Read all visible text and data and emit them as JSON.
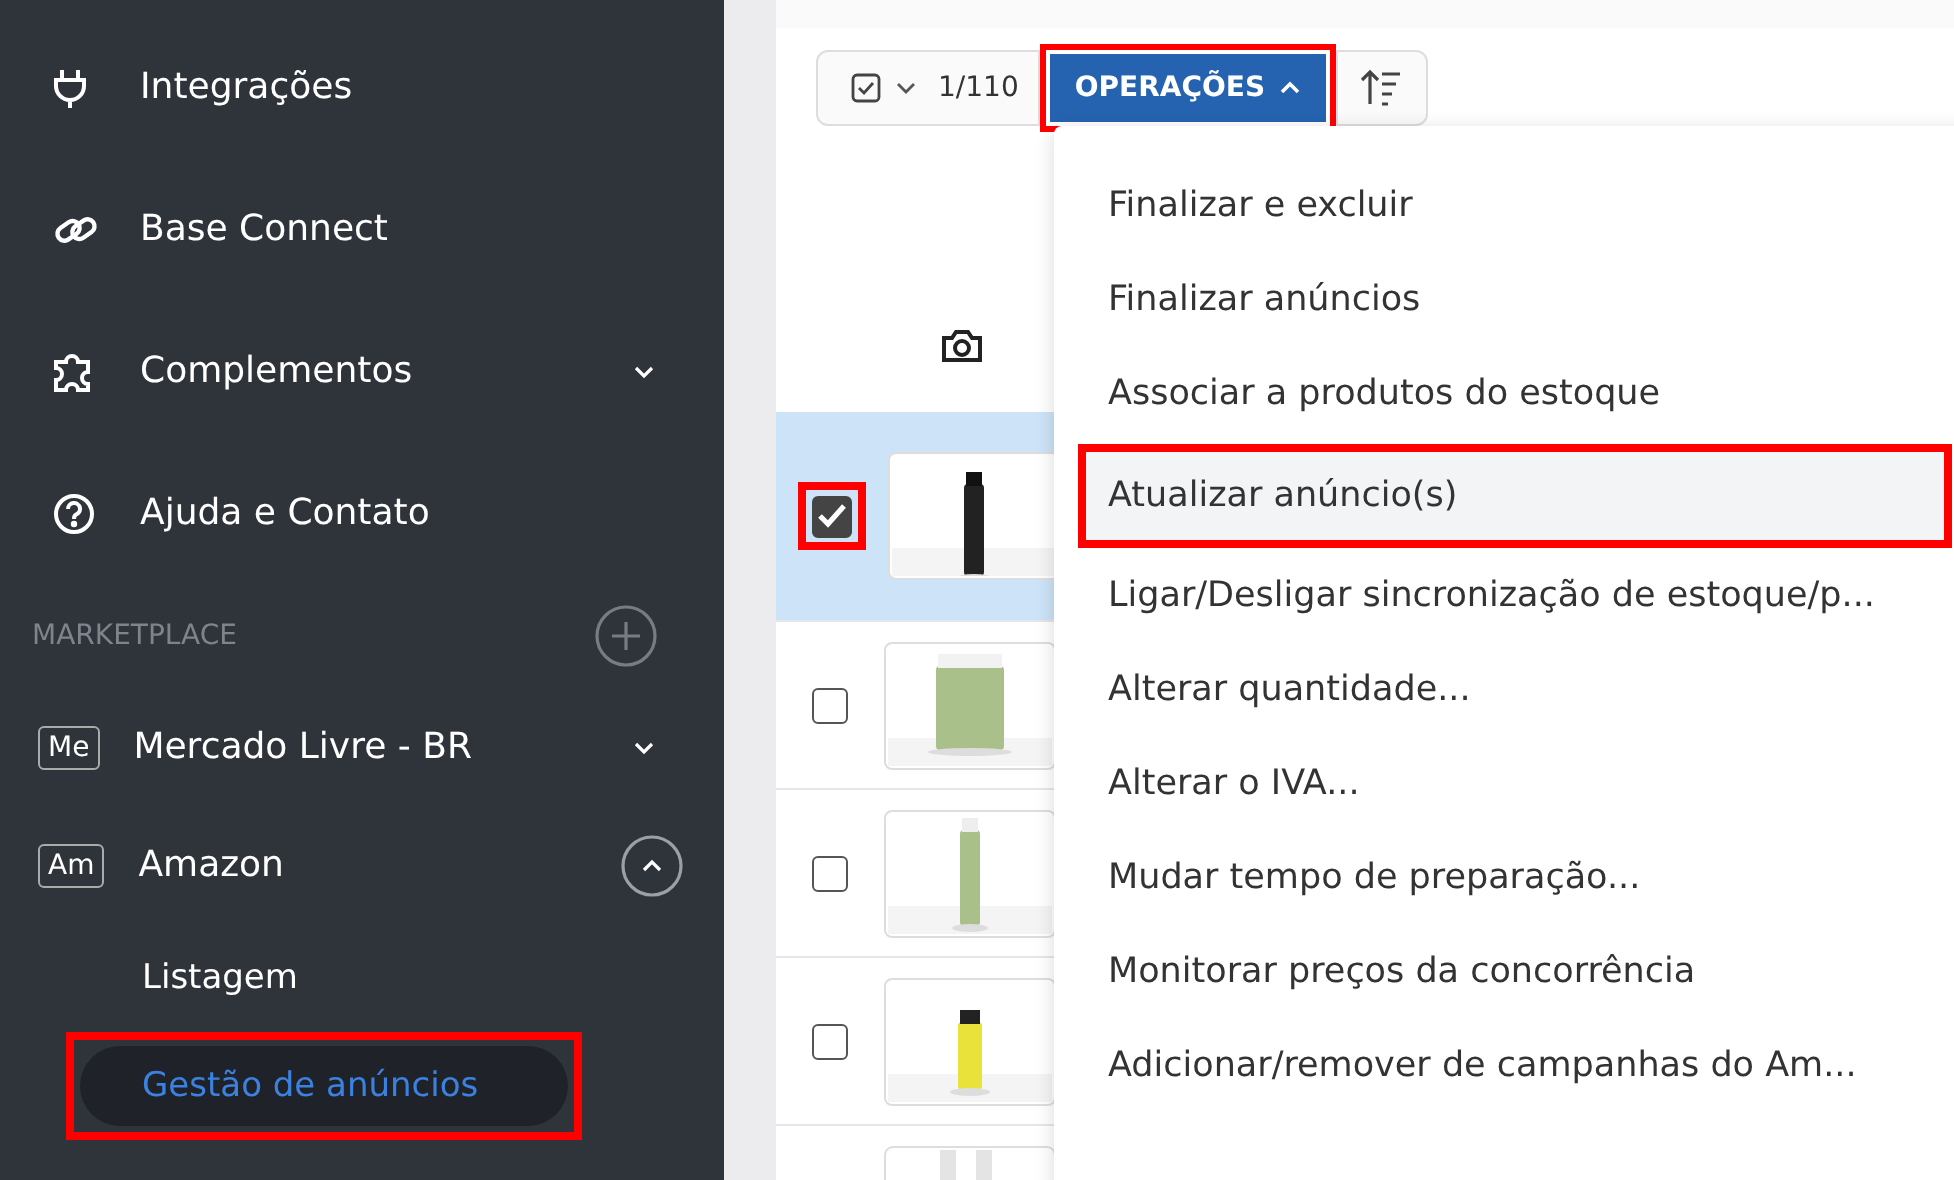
{
  "sidebar": {
    "items": [
      {
        "label": "Integrações",
        "expandable": false
      },
      {
        "label": "Base Connect",
        "expandable": false
      },
      {
        "label": "Complementos",
        "expandable": true
      },
      {
        "label": "Ajuda e Contato",
        "expandable": false
      }
    ],
    "section": {
      "title": "MARKETPLACE"
    },
    "marketplaces": [
      {
        "badge": "Me",
        "label": "Mercado Livre - BR",
        "expanded": false
      },
      {
        "badge": "Am",
        "label": "Amazon",
        "expanded": true,
        "children": [
          {
            "label": "Listagem",
            "selected": false,
            "highlighted": false
          },
          {
            "label": "Gestão de anúncios",
            "selected": true,
            "highlighted": true
          }
        ]
      }
    ]
  },
  "toolbar": {
    "selection_count": "1/110",
    "operations": {
      "label": "OPERAÇÕES",
      "open": true,
      "highlighted": true
    }
  },
  "rows": [
    {
      "checked": true,
      "highlighted": true
    },
    {
      "checked": false,
      "highlighted": false
    },
    {
      "checked": false,
      "highlighted": false
    },
    {
      "checked": false,
      "highlighted": false
    }
  ],
  "menu": {
    "items": [
      {
        "label": "Finalizar e excluir",
        "highlighted": false
      },
      {
        "label": "Finalizar anúncios",
        "highlighted": false
      },
      {
        "label": "Associar a produtos do estoque",
        "highlighted": false
      },
      {
        "label": "Atualizar anúncio(s)",
        "highlighted": true
      },
      {
        "label": "Ligar/Desligar sincronização de estoque/p...",
        "highlighted": false
      },
      {
        "label": "Alterar quantidade...",
        "highlighted": false
      },
      {
        "label": "Alterar o IVA...",
        "highlighted": false
      },
      {
        "label": "Mudar tempo de preparação...",
        "highlighted": false
      },
      {
        "label": "Monitorar preços da concorrência",
        "highlighted": false
      },
      {
        "label": "Adicionar/remover de campanhas do Am...",
        "highlighted": false
      }
    ]
  }
}
